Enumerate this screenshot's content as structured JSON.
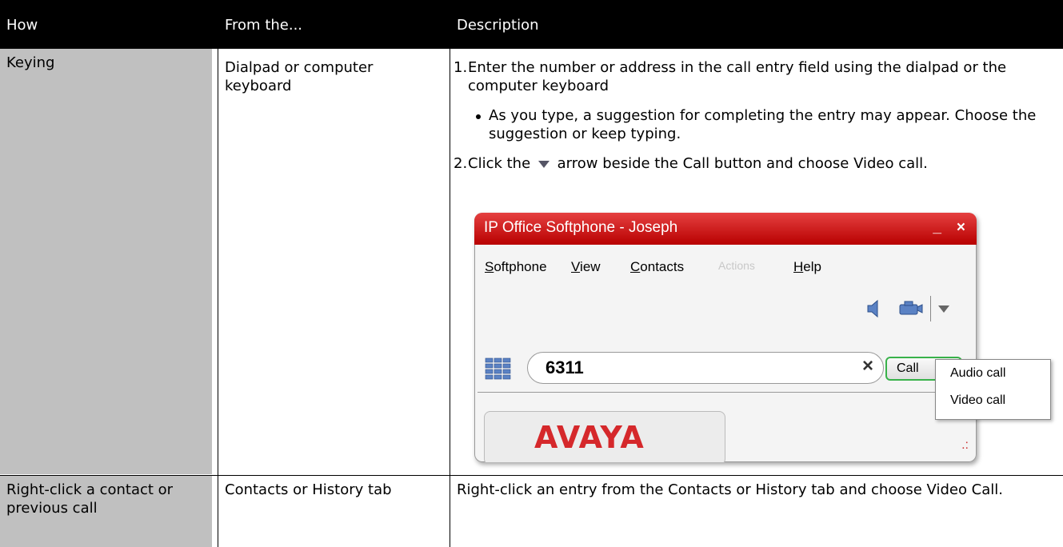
{
  "headers": [
    "How",
    "From the...",
    "Description"
  ],
  "rows": [
    {
      "how": "Keying",
      "from": "Dialpad or computer keyboard",
      "step1_num": "1.",
      "step1": "Enter the number or address in the call entry field using the dialpad or the computer keyboard",
      "bullet": "As you type, a suggestion for completing the entry may appear. Choose the suggestion or keep typing.",
      "step2_num": "2.",
      "step2_a": "Click the",
      "step2_b": "arrow beside the Call button and choose Video call."
    },
    {
      "how": "Right-click a contact or previous call",
      "from": "Contacts or History tab",
      "desc": "Right-click an entry from the Contacts or History tab and choose Video Call."
    }
  ],
  "softphone": {
    "title": "IP Office Softphone - Joseph",
    "min": "_",
    "close": "×",
    "menu": [
      {
        "first": "S",
        "rest": "oftphone"
      },
      {
        "first": "V",
        "rest": "iew"
      },
      {
        "first": "C",
        "rest": "ontacts"
      },
      {
        "first": "",
        "rest": "Actions"
      },
      {
        "first": "H",
        "rest": "elp"
      }
    ],
    "input_value": "6311",
    "clear": "×",
    "call_label": "Call",
    "dropdown": [
      "Audio call",
      "Video call"
    ],
    "logo": "AVAYA",
    "grip": ".:"
  }
}
